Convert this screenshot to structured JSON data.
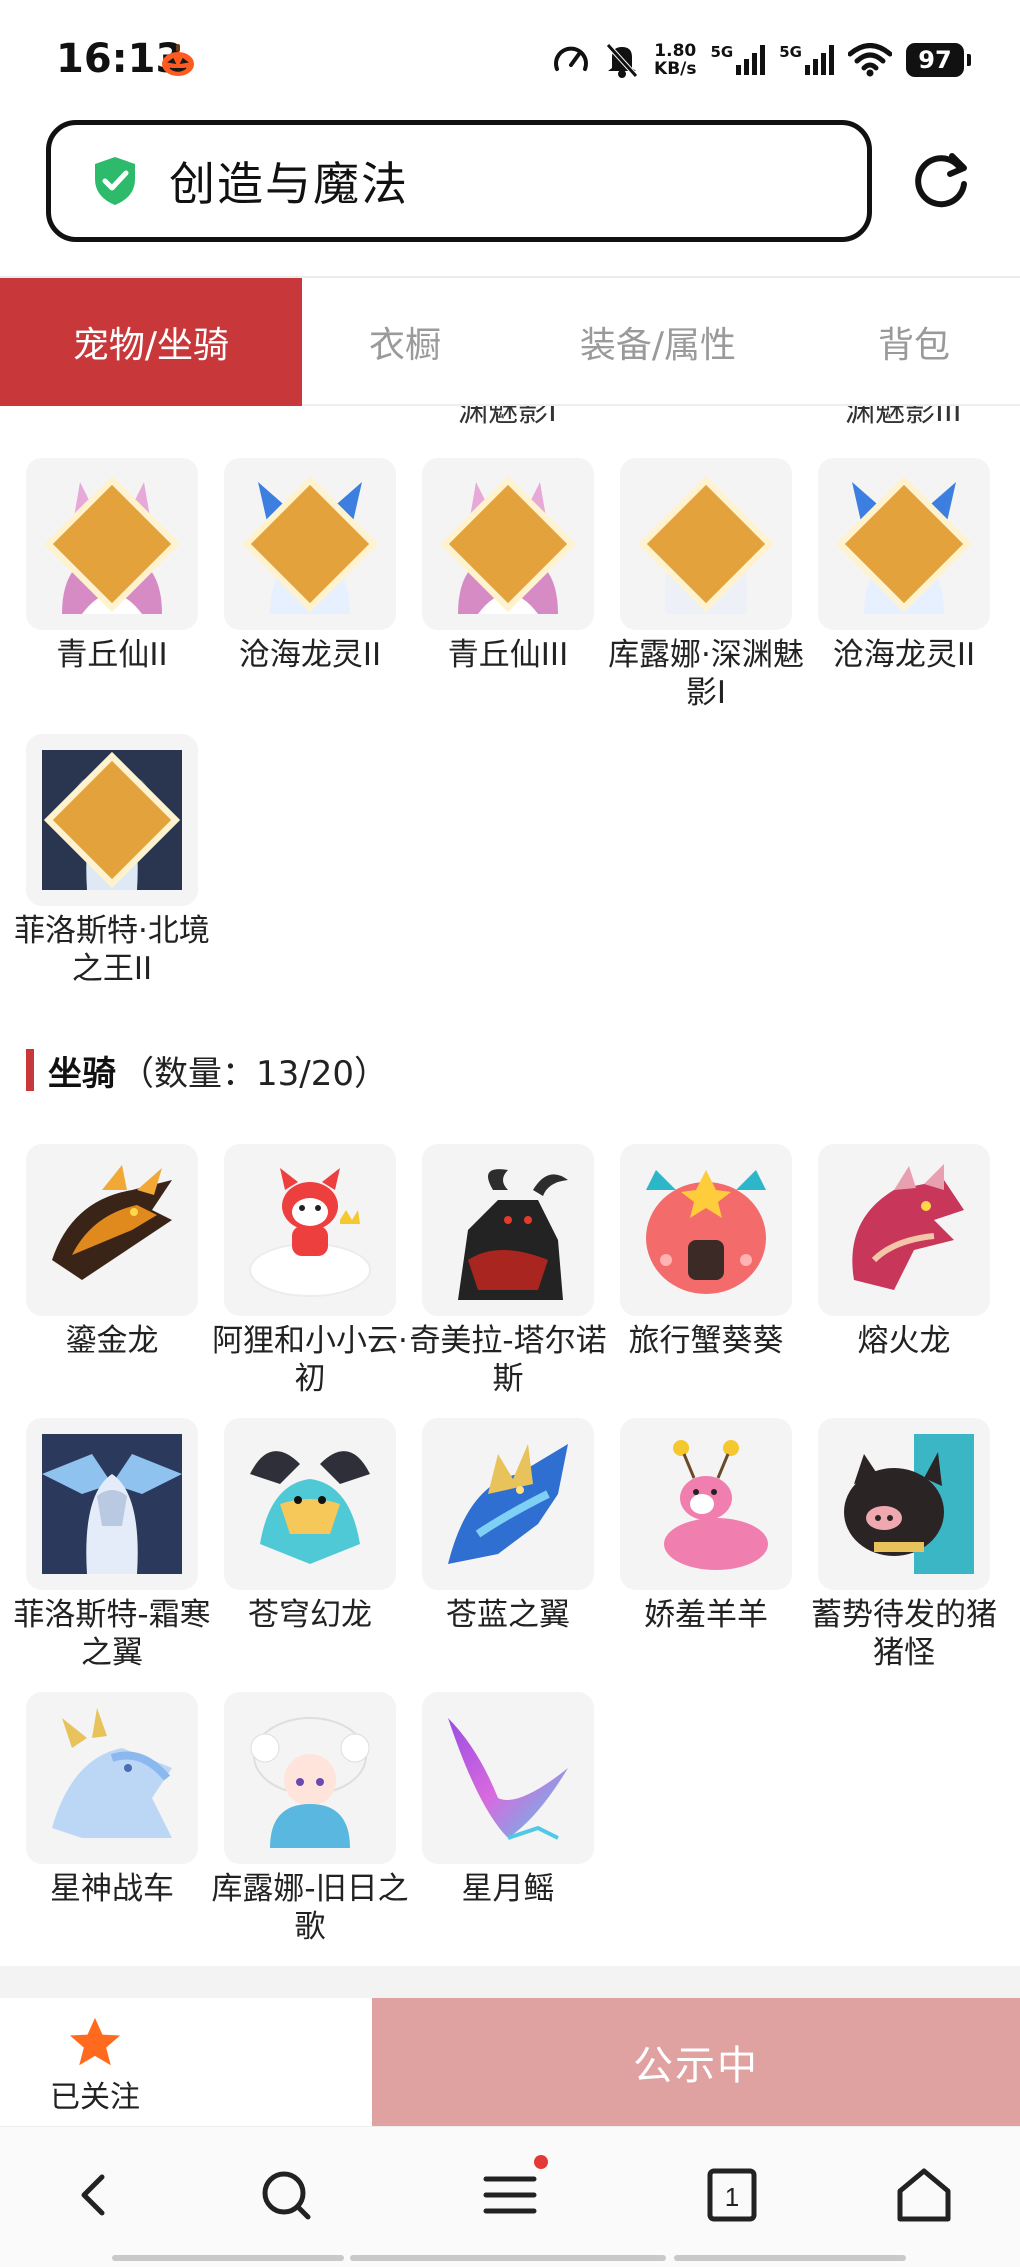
{
  "status_bar": {
    "time": "16:13",
    "speed_value": "1.80",
    "speed_unit": "KB/s",
    "net1": "5G",
    "net2": "5G",
    "battery": "97"
  },
  "url_bar": {
    "title": "创造与魔法"
  },
  "tabs": [
    {
      "label": "宠物/坐骑",
      "active": true
    },
    {
      "label": "衣橱",
      "active": false
    },
    {
      "label": "装备/属性",
      "active": false
    },
    {
      "label": "背包",
      "active": false
    }
  ],
  "clipped_labels": [
    "渊魅影I",
    "渊魅影III"
  ],
  "pets": [
    {
      "name": "青丘仙II",
      "rank": "II",
      "icon": "fox-spirit-icon"
    },
    {
      "name": "沧海龙灵II",
      "rank": "II",
      "icon": "sea-dragon-spirit-icon"
    },
    {
      "name": "青丘仙III",
      "rank": "III",
      "icon": "fox-spirit-icon"
    },
    {
      "name": "库露娜·深渊魅影I",
      "rank": "I",
      "icon": "kuluna-icon"
    },
    {
      "name": "沧海龙灵II",
      "rank": "II",
      "icon": "sea-dragon-spirit-icon"
    },
    {
      "name": "菲洛斯特·北境之王II",
      "rank": "II",
      "icon": "frost-king-icon"
    }
  ],
  "mounts_section": {
    "title": "坐骑",
    "count": "（数量：13/20）"
  },
  "mounts": [
    {
      "name": "鎏金龙",
      "icon": "golden-dragon-icon"
    },
    {
      "name": "阿狸和小小云·初",
      "icon": "ali-cloud-icon"
    },
    {
      "name": "奇美拉-塔尔诺斯",
      "icon": "chimera-icon"
    },
    {
      "name": "旅行蟹葵葵",
      "icon": "travel-crab-icon"
    },
    {
      "name": "熔火龙",
      "icon": "lava-dragon-icon"
    },
    {
      "name": "菲洛斯特-霜寒之翼",
      "icon": "frost-wing-icon"
    },
    {
      "name": "苍穹幻龙",
      "icon": "sky-dragon-icon"
    },
    {
      "name": "苍蓝之翼",
      "icon": "azure-wing-icon"
    },
    {
      "name": "娇羞羊羊",
      "icon": "shy-sheep-icon"
    },
    {
      "name": "蓄势待发的猪猪怪",
      "icon": "pig-monster-icon"
    },
    {
      "name": "星神战车",
      "icon": "star-chariot-icon"
    },
    {
      "name": "库露娜-旧日之歌",
      "icon": "kuluna-song-icon"
    },
    {
      "name": "星月鳐",
      "icon": "star-ray-icon"
    }
  ],
  "action_bar": {
    "follow_label": "已关注",
    "public_label": "公示中"
  },
  "colors": {
    "accent": "#c8383a",
    "public_button": "#e0a1a1",
    "follow_star": "#ff6a1f"
  },
  "nav_bar": {
    "tab_count": "1"
  }
}
